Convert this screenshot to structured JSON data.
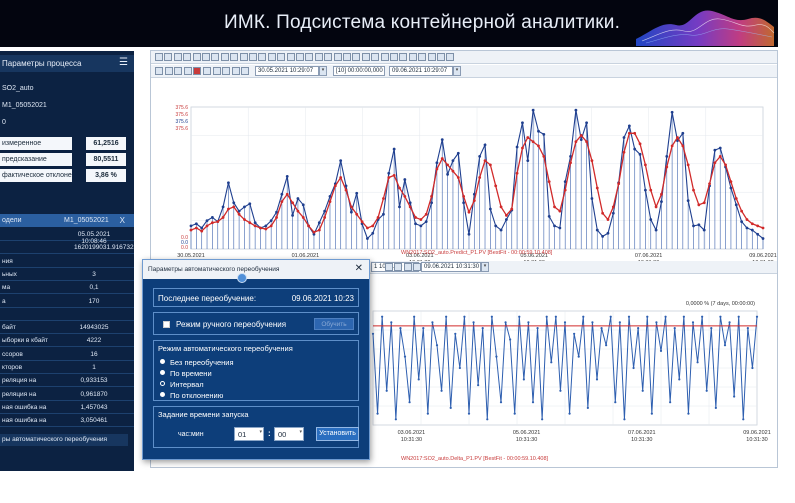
{
  "header": {
    "title": "ИМК. Подсистема контейнерной аналитики."
  },
  "left_panel": {
    "title": "Параметры процесса",
    "tag": "SO2_auto",
    "model_name": "M1_05052021",
    "index": "0",
    "metrics": [
      {
        "label": "измеренное",
        "value": "61,2516"
      },
      {
        "label": "предсказание",
        "value": "80,5511"
      },
      {
        "label": "фактическое отклонение",
        "value": "3,86 %"
      }
    ],
    "model_header": {
      "label": "одели",
      "value": "M1_05052021",
      "close": "X"
    },
    "model_rows": [
      {
        "key": "",
        "value": "05.05.2021 10:08:46"
      },
      {
        "key": "",
        "value": "1620199031.9167323"
      },
      {
        "key": "ния",
        "value": ""
      },
      {
        "key": "ьных",
        "value": "3"
      },
      {
        "key": "ма",
        "value": "0,1"
      },
      {
        "key": "а",
        "value": "170"
      },
      {
        "key": "",
        "value": ""
      },
      {
        "key": "байт",
        "value": "14943025"
      },
      {
        "key": "ыборки в кбайт",
        "value": "4222"
      },
      {
        "key": "ссоров",
        "value": "16"
      },
      {
        "key": "кторов",
        "value": "1"
      },
      {
        "key": "реляция на",
        "value": "0,933153"
      },
      {
        "key": "реляция на",
        "value": "0,961870"
      },
      {
        "key": "ная ошибка на",
        "value": "1,457043"
      },
      {
        "key": "ная ошибка на",
        "value": "3,050461"
      }
    ],
    "footer": "ры автоматического переобучения"
  },
  "toolbar": {
    "start_datetime": "30.05.2021 10:29:07",
    "interval": "[10] 00:00:00,000",
    "end_datetime": "09.06.2021 10:29:07",
    "lower_start": "1 10:31:30",
    "lower_end": "09.06.2021 10:31:30"
  },
  "chart_data": [
    {
      "type": "line",
      "y_tick_labels": [
        "375.6",
        "375.6",
        "375.6",
        "375.6",
        "0.0",
        "0.0",
        "0.0"
      ],
      "x_tick_labels": [
        "30.05.2021\n10:31:30",
        "01.06.2021\n10:31:30",
        "03.06.2021\n10:31:30",
        "05.06.2021\n10:31:30",
        "07.06.2021\n10:31:30",
        "09.06.2021\n10:31:30"
      ],
      "caption": "WN2017:SO2_auto.Predict_P1.PV [BestFit - 00:00:59.10.408]",
      "colors": {
        "measured": "#1f3f8f",
        "predicted": "#d12a2a"
      },
      "series": [
        {
          "values": [
            22,
            24,
            20,
            27,
            30,
            26,
            40,
            63,
            44,
            36,
            40,
            43,
            25,
            20,
            22,
            27,
            35,
            52,
            69,
            32,
            48,
            42,
            22,
            14,
            25,
            36,
            50,
            62,
            84,
            60,
            35,
            53,
            24,
            10,
            15,
            28,
            33,
            72,
            95,
            40,
            66,
            44,
            24,
            22,
            26,
            44,
            82,
            104,
            71,
            84,
            91,
            44,
            14,
            52,
            88,
            99,
            38,
            22,
            18,
            28,
            37,
            97,
            120,
            84,
            132,
            112,
            109,
            31,
            22,
            20,
            64,
            88,
            132,
            104,
            120,
            48,
            18,
            12,
            15,
            34,
            63,
            106,
            117,
            95,
            90,
            56,
            28,
            18,
            45,
            88,
            130,
            103,
            110,
            46,
            22,
            23,
            18,
            60,
            94,
            96,
            78,
            58,
            42,
            26,
            20,
            18,
            14,
            10
          ]
        },
        {
          "values": [
            18,
            20,
            17,
            22,
            25,
            26,
            30,
            38,
            40,
            33,
            28,
            25,
            22,
            20,
            19,
            22,
            30,
            45,
            52,
            44,
            36,
            30,
            22,
            16,
            18,
            30,
            45,
            60,
            68,
            56,
            40,
            33,
            26,
            20,
            22,
            30,
            48,
            68,
            70,
            58,
            50,
            40,
            30,
            28,
            33,
            50,
            76,
            86,
            80,
            74,
            68,
            50,
            35,
            46,
            68,
            84,
            80,
            60,
            40,
            32,
            38,
            72,
            96,
            106,
            102,
            98,
            88,
            64,
            40,
            36,
            56,
            82,
            102,
            108,
            102,
            84,
            58,
            34,
            28,
            40,
            62,
            92,
            110,
            110,
            100,
            80,
            56,
            40,
            52,
            78,
            98,
            106,
            98,
            80,
            56,
            42,
            44,
            62,
            82,
            88,
            80,
            64,
            48,
            36,
            28,
            24,
            22,
            20
          ]
        }
      ]
    },
    {
      "type": "line",
      "x_tick_labels": [
        "03.06.2021\n10:31:30",
        "05.06.2021\n10:31:30",
        "07.06.2021\n10:31:30",
        "09.06.2021\n10:31:30"
      ],
      "annotation": "0,0000 % (7 days, 00:00:00)",
      "threshold_color": "#d12a2a",
      "caption": "WN2017:SO2_auto.Delta_P1.PV [BestFit - 00:00:59.10.408]",
      "series": [
        {
          "values": [
            0.8,
            0.1,
            0.95,
            0.3,
            0.9,
            0.05,
            0.85,
            0.6,
            0.2,
            0.95,
            0.4,
            0.85,
            0.1,
            0.9,
            0.7,
            0.3,
            0.95,
            0.15,
            0.8,
            0.5,
            0.95,
            0.1,
            0.9,
            0.35,
            0.85,
            0.05,
            0.95,
            0.6,
            0.2,
            0.9,
            0.75,
            0.1,
            0.95,
            0.4,
            0.9,
            0.2,
            0.85,
            0.05,
            0.95,
            0.55,
            0.95,
            0.3,
            0.9,
            0.1,
            0.8,
            0.6,
            0.95,
            0.15,
            0.9,
            0.4,
            0.85,
            0.7,
            0.95,
            0.2,
            0.9,
            0.05,
            0.95,
            0.5,
            0.85,
            0.3,
            0.95,
            0.1,
            0.9,
            0.65,
            0.95,
            0.2,
            0.85,
            0.4,
            0.95,
            0.1,
            0.9,
            0.55,
            0.95,
            0.3,
            0.85,
            0.15,
            0.95,
            0.7,
            0.9,
            0.25,
            0.95,
            0.05,
            0.85,
            0.5,
            0.95
          ]
        }
      ]
    }
  ],
  "dialog": {
    "title": "Параметры автоматического переобучения",
    "close": "✕",
    "last_retrain_label": "Последнее переобучение:",
    "last_retrain_value": "09.06.2021 10:23",
    "manual_label": "Режим ручного переобучения",
    "manual_button": "Обучить",
    "mode_title": "Режим автоматического переобучения",
    "modes": [
      "Без переобучения",
      "По времени",
      "Интервал",
      "По отклонению"
    ],
    "start_title": "Задание времени запуска",
    "time_label": "час:мин",
    "hour": "01",
    "minute": "00",
    "set_button": "Установить"
  }
}
